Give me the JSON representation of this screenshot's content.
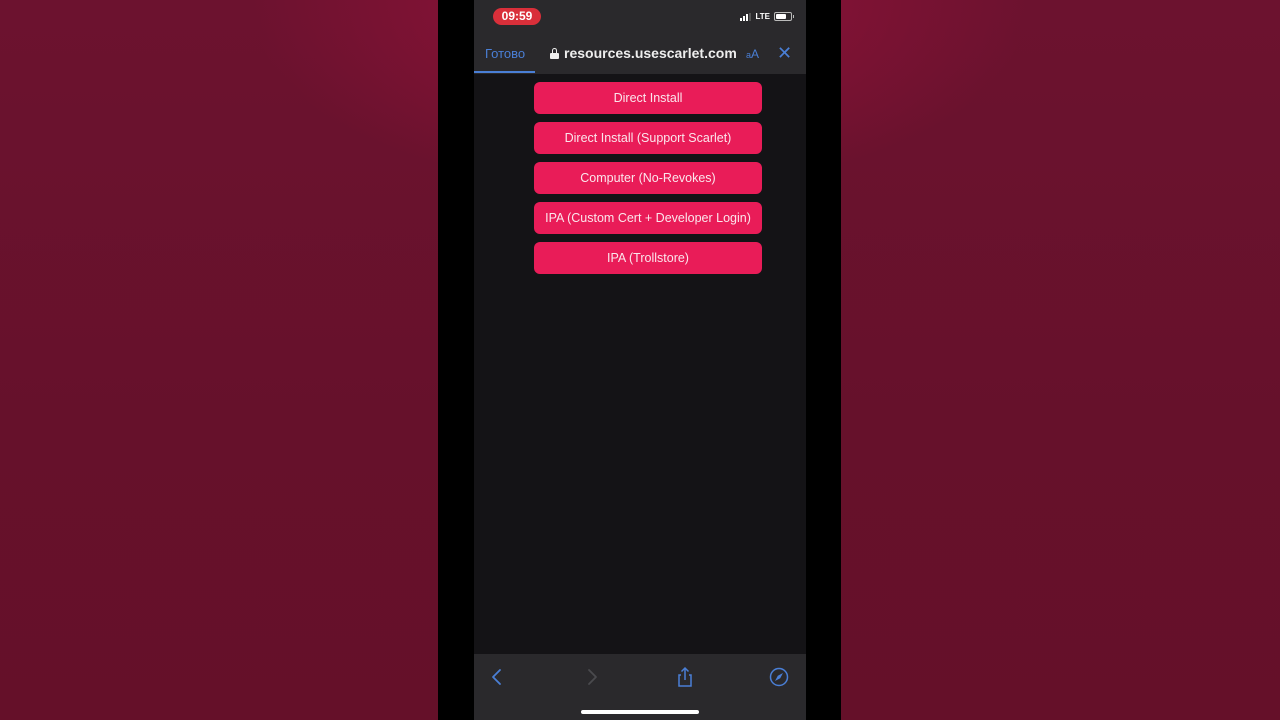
{
  "status_bar": {
    "time": "09:59",
    "network": "LTE",
    "signal_bars": 3,
    "battery_level": 0.7
  },
  "browser": {
    "done_label": "Готово",
    "url": "resources.usescarlet.com",
    "aa_label": "AA",
    "icons": {
      "lock": "lock-icon",
      "close": "close-icon",
      "back": "chevron-left-icon",
      "forward": "chevron-right-icon",
      "share": "share-icon",
      "safari": "compass-icon"
    }
  },
  "page": {
    "buttons": [
      {
        "label": "Direct Install"
      },
      {
        "label": "Direct Install (Support Scarlet)"
      },
      {
        "label": "Computer (No-Revokes)"
      },
      {
        "label": "IPA (Custom Cert + Developer Login)"
      },
      {
        "label": "IPA (Trollstore)"
      }
    ]
  },
  "colors": {
    "accent_button": "#e91c58",
    "browser_accent": "#4a7fd6",
    "time_pill": "#d92f3a",
    "backdrop": "#66112b"
  }
}
